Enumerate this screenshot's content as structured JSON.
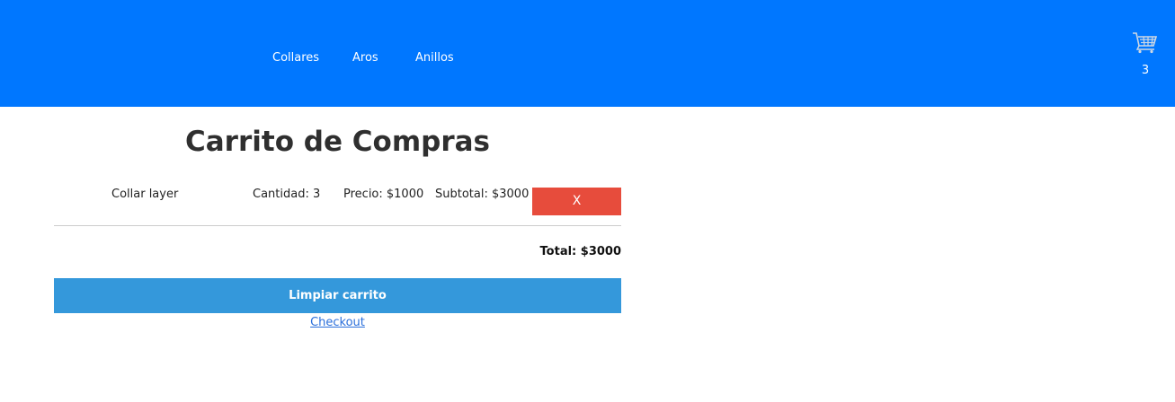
{
  "nav": {
    "links": [
      "Collares",
      "Aros",
      "Anillos"
    ],
    "cart_icon": "shopping-cart-icon",
    "cart_count": "3"
  },
  "page": {
    "title": "Carrito de Compras"
  },
  "cart": {
    "items": [
      {
        "name": "Collar layer",
        "quantity": "Cantidad: 3",
        "price": "Precio: $1000",
        "subtotal": "Subtotal: $3000",
        "remove_label": "X"
      }
    ],
    "total": "Total: $3000",
    "clear_label": "Limpiar carrito",
    "checkout_label": "Checkout"
  },
  "colors": {
    "navbar": "#0077ff",
    "remove_button": "#e74c3c",
    "clear_button": "#3498db",
    "link": "#2a6fdb"
  }
}
